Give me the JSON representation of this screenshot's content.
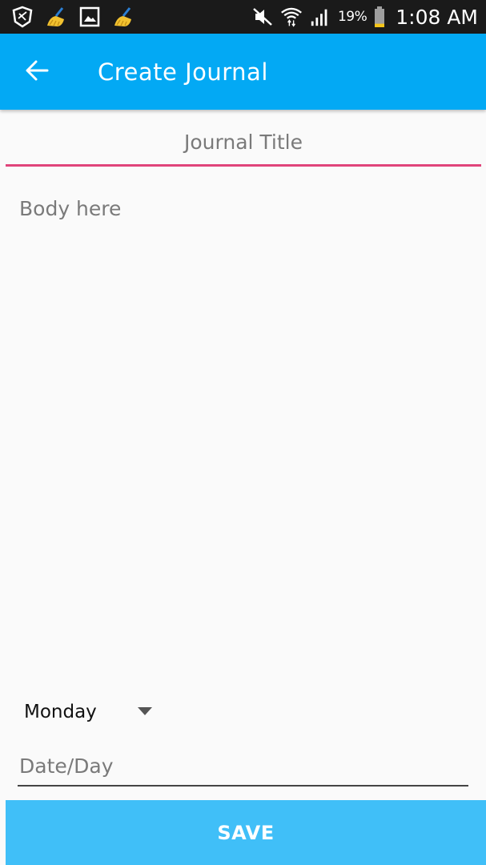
{
  "status_bar": {
    "icons_left": [
      "shield-icon",
      "broom-icon",
      "image-icon",
      "broom-icon"
    ],
    "icons_right": [
      "mute-icon",
      "wifi-icon",
      "signal-icon"
    ],
    "battery_percent": "19%",
    "battery_level": 0.19,
    "time": "1:08 AM"
  },
  "app_bar": {
    "title": "Create Journal",
    "back_icon": "arrow-back-icon",
    "color": "#03a9f4"
  },
  "form": {
    "title_placeholder": "Journal Title",
    "title_value": "",
    "body_placeholder": "Body here",
    "body_value": "",
    "day_selected": "Monday",
    "date_placeholder": "Date/Day",
    "date_value": ""
  },
  "actions": {
    "save_label": "SAVE",
    "save_color": "#40bff8"
  },
  "colors": {
    "accent_underline": "#e0457b"
  }
}
